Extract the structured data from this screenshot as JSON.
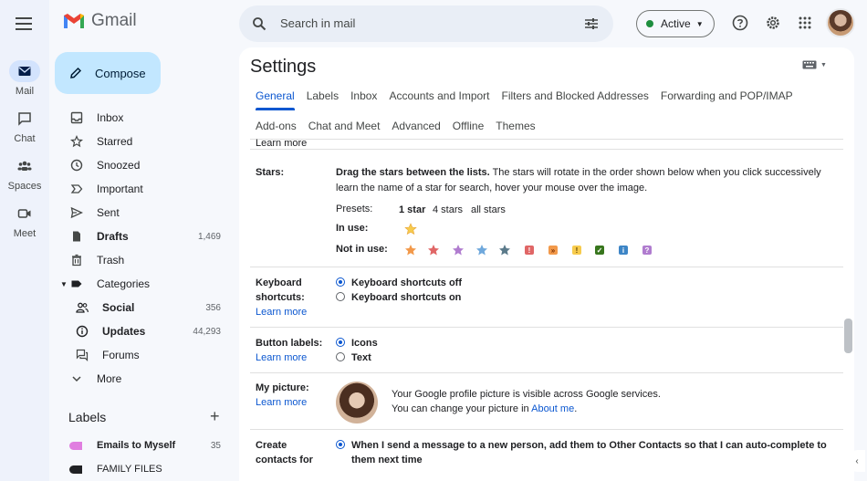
{
  "app": {
    "name": "Gmail"
  },
  "rail": [
    {
      "label": "Mail",
      "icon": "mail-icon"
    },
    {
      "label": "Chat",
      "icon": "chat-icon"
    },
    {
      "label": "Spaces",
      "icon": "spaces-icon"
    },
    {
      "label": "Meet",
      "icon": "meet-icon"
    }
  ],
  "compose": {
    "label": "Compose"
  },
  "nav": [
    {
      "label": "Inbox",
      "count": ""
    },
    {
      "label": "Starred",
      "count": ""
    },
    {
      "label": "Snoozed",
      "count": ""
    },
    {
      "label": "Important",
      "count": ""
    },
    {
      "label": "Sent",
      "count": ""
    },
    {
      "label": "Drafts",
      "count": "1,469"
    },
    {
      "label": "Trash",
      "count": ""
    },
    {
      "label": "Categories",
      "count": ""
    },
    {
      "label": "Social",
      "count": "356"
    },
    {
      "label": "Updates",
      "count": "44,293"
    },
    {
      "label": "Forums",
      "count": ""
    },
    {
      "label": "More",
      "count": ""
    }
  ],
  "labels": {
    "heading": "Labels",
    "add": "+",
    "items": [
      {
        "label": "Emails to Myself",
        "count": "35",
        "color": "#e07ee0"
      },
      {
        "label": "FAMILY FILES",
        "count": "",
        "color": "#202124"
      }
    ]
  },
  "search": {
    "placeholder": "Search in mail"
  },
  "status": {
    "label": "Active"
  },
  "settings": {
    "title": "Settings",
    "tabs_row1": [
      "General",
      "Labels",
      "Inbox",
      "Accounts and Import",
      "Filters and Blocked Addresses",
      "Forwarding and POP/IMAP"
    ],
    "tabs_row2": [
      "Add-ons",
      "Chat and Meet",
      "Advanced",
      "Offline",
      "Themes"
    ],
    "learn_more": "Learn more",
    "stars": {
      "label": "Stars:",
      "desc_bold": "Drag the stars between the lists.",
      "desc_rest": "The stars will rotate in the order shown below when you click successively",
      "desc_line2": "learn the name of a star for search, hover your mouse over the image.",
      "presets_label": "Presets:",
      "preset_1": "1 star",
      "preset_4": "4 stars",
      "preset_all": "all stars",
      "in_use_label": "In use:",
      "not_in_use_label": "Not in use:"
    },
    "keyboard": {
      "label_line1": "Keyboard",
      "label_line2": "shortcuts:",
      "off": "Keyboard shortcuts off",
      "on": "Keyboard shortcuts on"
    },
    "button_labels": {
      "label": "Button labels:",
      "icons": "Icons",
      "text": "Text"
    },
    "my_picture": {
      "label": "My picture:",
      "line1": "Your Google profile picture is visible across Google services.",
      "line2": "You can change your picture in",
      "link": "About me",
      "period": "."
    },
    "create_contacts": {
      "label_line1": "Create",
      "label_line2": "contacts for",
      "option_line1": "When I send a message to a new person, add them to Other Contacts so that I can auto-complete to",
      "option_line2": "them next time"
    }
  }
}
